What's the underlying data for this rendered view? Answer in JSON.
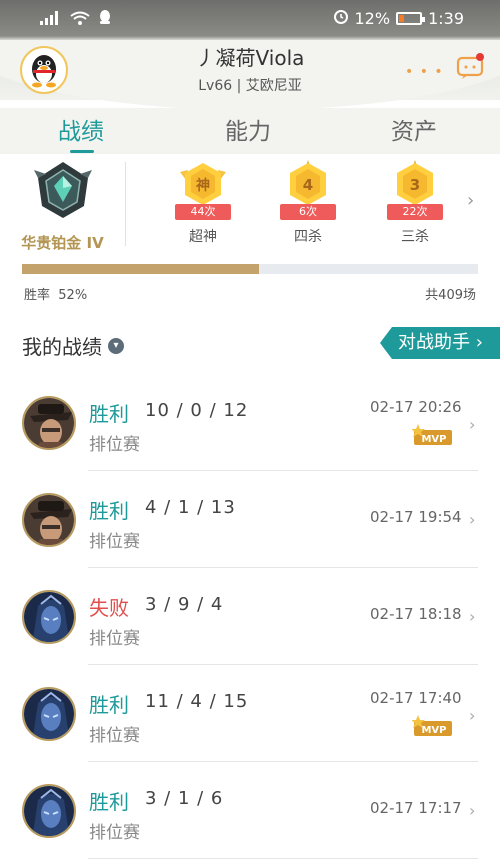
{
  "status_bar": {
    "battery_pct": "12%",
    "time": "1:39"
  },
  "profile": {
    "nickname": "丿凝荷Viola",
    "server": "Lv66 | 艾欧尼亚"
  },
  "tabs": [
    {
      "label": "战绩",
      "active": true
    },
    {
      "label": "能力",
      "active": false
    },
    {
      "label": "资产",
      "active": false
    }
  ],
  "rank": {
    "name": "华贵铂金 IV"
  },
  "badges": [
    {
      "glyph": "神",
      "count": "44次",
      "label": "超神"
    },
    {
      "glyph": "4",
      "count": "6次",
      "label": "四杀"
    },
    {
      "glyph": "3",
      "count": "22次",
      "label": "三杀"
    }
  ],
  "winrate": {
    "label": "胜率",
    "value": "52%",
    "fraction": 0.52,
    "total": "共409场"
  },
  "history": {
    "title": "我的战绩",
    "assistant_label": "对战助手"
  },
  "matches": [
    {
      "result": "胜利",
      "win": true,
      "kda": "10 / 0 / 12",
      "mode": "排位赛",
      "time": "02-17 20:26",
      "mvp": true,
      "champ": "gunner"
    },
    {
      "result": "胜利",
      "win": true,
      "kda": "4 / 1 / 13",
      "mode": "排位赛",
      "time": "02-17 19:54",
      "mvp": false,
      "champ": "gunner"
    },
    {
      "result": "失败",
      "win": false,
      "kda": "3 / 9 / 4",
      "mode": "排位赛",
      "time": "02-17 18:18",
      "mvp": false,
      "champ": "mage"
    },
    {
      "result": "胜利",
      "win": true,
      "kda": "11 / 4 / 15",
      "mode": "排位赛",
      "time": "02-17 17:40",
      "mvp": true,
      "champ": "mage"
    },
    {
      "result": "胜利",
      "win": true,
      "kda": "3 / 1 / 6",
      "mode": "排位赛",
      "time": "02-17 17:17",
      "mvp": false,
      "champ": "mage"
    }
  ],
  "mvp_label": "MVP",
  "colors": {
    "accent": "#1f9a9a",
    "lose": "#e04f4f",
    "gold": "#c3a36b",
    "badge_red": "#ef5b5b"
  }
}
